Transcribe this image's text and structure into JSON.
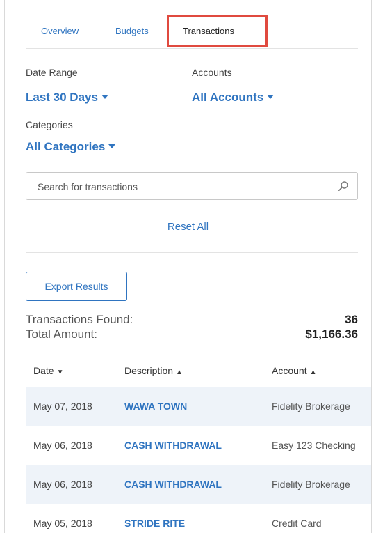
{
  "tabs": [
    {
      "label": "Overview",
      "active": false
    },
    {
      "label": "Budgets",
      "active": false
    },
    {
      "label": "Transactions",
      "active": true
    }
  ],
  "filters": {
    "date_range": {
      "label": "Date Range",
      "value": "Last 30 Days"
    },
    "accounts": {
      "label": "Accounts",
      "value": "All Accounts"
    },
    "categories": {
      "label": "Categories",
      "value": "All Categories"
    }
  },
  "search": {
    "placeholder": "Search for transactions",
    "icon": "search-icon"
  },
  "reset_label": "Reset All",
  "export_label": "Export Results",
  "stats": {
    "found_label": "Transactions Found:",
    "found_value": "36",
    "total_label": "Total Amount:",
    "total_value": "$1,166.36"
  },
  "table": {
    "headers": [
      {
        "label": "Date",
        "sort": "desc"
      },
      {
        "label": "Description",
        "sort": "asc"
      },
      {
        "label": "Account",
        "sort": "asc"
      }
    ],
    "rows": [
      {
        "date": "May 07, 2018",
        "description": "WAWA TOWN",
        "account": "Fidelity Brokerage"
      },
      {
        "date": "May 06, 2018",
        "description": "CASH WITHDRAWAL",
        "account": "Easy 123 Checking"
      },
      {
        "date": "May 06, 2018",
        "description": "CASH WITHDRAWAL",
        "account": "Fidelity Brokerage"
      },
      {
        "date": "May 05, 2018",
        "description": "STRIDE RITE",
        "account": "Credit Card"
      }
    ]
  },
  "colors": {
    "accent": "#2f74c0",
    "highlight": "#e04a3f",
    "row_shade": "#eef3f9"
  }
}
